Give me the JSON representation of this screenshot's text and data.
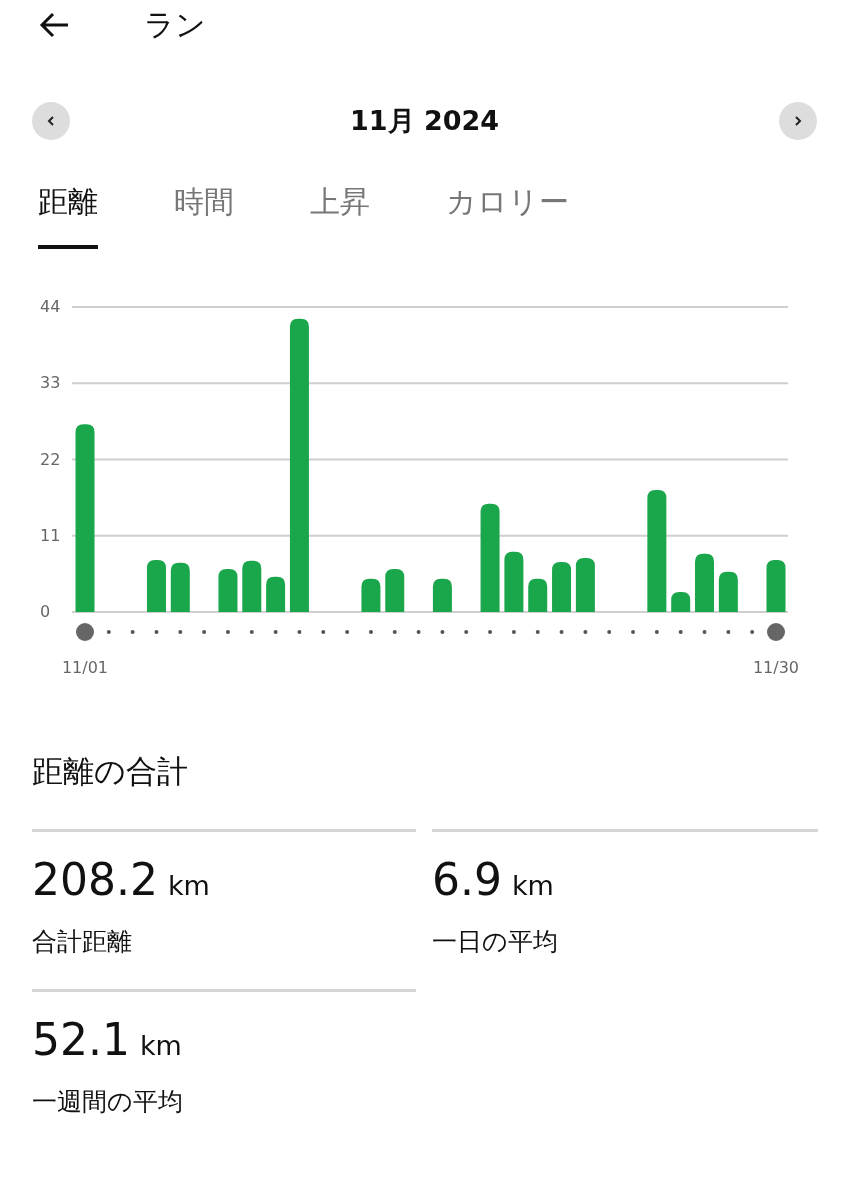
{
  "header": {
    "title": "ラン"
  },
  "period": {
    "label": "11月 2024"
  },
  "tabs": [
    {
      "label": "距離",
      "selected": true
    },
    {
      "label": "時間",
      "selected": false
    },
    {
      "label": "上昇",
      "selected": false
    },
    {
      "label": "カロリー",
      "selected": false
    }
  ],
  "chart_data": {
    "type": "bar",
    "categories": [
      "11/01",
      null,
      null,
      null,
      null,
      null,
      null,
      null,
      null,
      null,
      null,
      null,
      null,
      null,
      null,
      null,
      null,
      null,
      null,
      null,
      null,
      null,
      null,
      null,
      null,
      null,
      null,
      null,
      null,
      "11/30"
    ],
    "series": [
      {
        "color": "#1aa64a",
        "values": [
          27.1,
          null,
          null,
          7.5,
          7.1,
          null,
          6.2,
          7.4,
          5.1,
          42.3,
          null,
          null,
          4.8,
          6.2,
          null,
          4.8,
          null,
          15.6,
          8.7,
          4.8,
          7.2,
          7.8,
          null,
          null,
          17.6,
          2.9,
          8.4,
          5.8,
          null,
          7.5
        ]
      }
    ],
    "ylim": [
      0,
      44
    ],
    "yticks": [
      0,
      11,
      22,
      33,
      44
    ],
    "grid": true
  },
  "summary": {
    "title": "距離の合計",
    "stats": [
      {
        "value": "208.2",
        "unit": "km",
        "label": "合計距離"
      },
      {
        "value": "6.9",
        "unit": "km",
        "label": "一日の平均"
      },
      {
        "value": "52.1",
        "unit": "km",
        "label": "一週間の平均"
      }
    ]
  }
}
